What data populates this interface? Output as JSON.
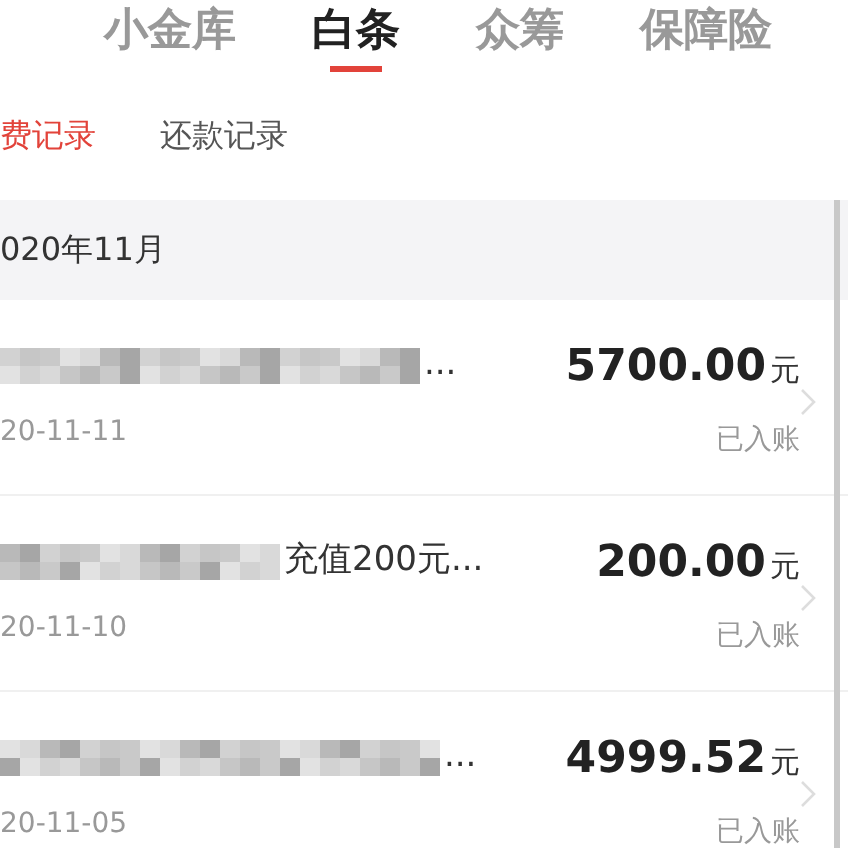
{
  "top_tabs": [
    {
      "label": "小金库",
      "selected": false
    },
    {
      "label": "白条",
      "selected": true
    },
    {
      "label": "众筹",
      "selected": false
    },
    {
      "label": "保障险",
      "selected": false
    }
  ],
  "sub_tabs": [
    {
      "label": "费记录",
      "selected": true
    },
    {
      "label": "还款记录",
      "selected": false
    }
  ],
  "month": "020年11月",
  "records": [
    {
      "title": "...",
      "date": "20-11-11",
      "amount": "5700.00",
      "unit": "元",
      "status": "已入账"
    },
    {
      "title": "充值200元...",
      "date": "20-11-10",
      "amount": "200.00",
      "unit": "元",
      "status": "已入账"
    },
    {
      "title": "...",
      "date": "20-11-05",
      "amount": "4999.52",
      "unit": "元",
      "status": "已入账"
    }
  ]
}
